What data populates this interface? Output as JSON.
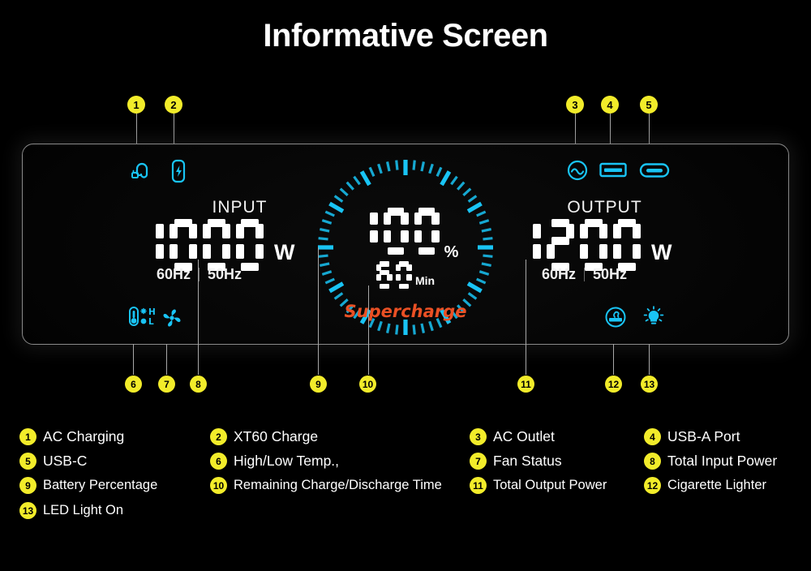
{
  "page": {
    "title": "Informative Screen",
    "background_color": "#000000",
    "accent_badge_color": "#F2EC2A",
    "icon_color": "#19C4F5",
    "supercharge_color": "#EA5024",
    "display_text_color": "#FFFFFF"
  },
  "display": {
    "input": {
      "heading": "INPUT",
      "value": "1000",
      "unit": "W",
      "freq_options": [
        "60Hz",
        "50Hz"
      ]
    },
    "output": {
      "heading": "OUTPUT",
      "value": "1200",
      "unit": "W",
      "freq_options": [
        "60Hz",
        "50Hz"
      ]
    },
    "gauge": {
      "percent_value": "100",
      "percent_unit": "%",
      "time_value": "60",
      "time_unit": "Min",
      "status_label": "Supercharge",
      "tick_count": 60,
      "major_tick_every": 5
    },
    "top_icons": [
      {
        "id": 1,
        "name": "ac-charging-icon",
        "glyph": "plug-cable"
      },
      {
        "id": 2,
        "name": "xt60-charge-icon",
        "glyph": "battery-bolt"
      },
      {
        "id": 3,
        "name": "ac-outlet-icon",
        "glyph": "circle-sine"
      },
      {
        "id": 4,
        "name": "usb-a-port-icon",
        "glyph": "rect-usb-a"
      },
      {
        "id": 5,
        "name": "usb-c-port-icon",
        "glyph": "oval-usb-c"
      }
    ],
    "bottom_icons": [
      {
        "id": 6,
        "name": "high-low-temp-icon",
        "glyph": "thermometer",
        "high_label": "H",
        "low_label": "L"
      },
      {
        "id": 7,
        "name": "fan-status-icon",
        "glyph": "fan"
      },
      {
        "id": 12,
        "name": "cigarette-lighter-icon",
        "glyph": "circle-lighter"
      },
      {
        "id": 13,
        "name": "led-light-icon",
        "glyph": "bulb"
      }
    ]
  },
  "callouts": [
    {
      "id": "1",
      "number": "1"
    },
    {
      "id": "2",
      "number": "2"
    },
    {
      "id": "3",
      "number": "3"
    },
    {
      "id": "4",
      "number": "4"
    },
    {
      "id": "5",
      "number": "5"
    },
    {
      "id": "6",
      "number": "6"
    },
    {
      "id": "7",
      "number": "7"
    },
    {
      "id": "8",
      "number": "8"
    },
    {
      "id": "9",
      "number": "9"
    },
    {
      "id": "10",
      "number": "10"
    },
    {
      "id": "11",
      "number": "11"
    },
    {
      "id": "12",
      "number": "12"
    },
    {
      "id": "13",
      "number": "13"
    }
  ],
  "legend": {
    "rows": [
      [
        {
          "number": "1",
          "label": "AC Charging"
        },
        {
          "number": "2",
          "label": "XT60 Charge"
        },
        {
          "number": "3",
          "label": "AC Outlet"
        },
        {
          "number": "4",
          "label": "USB-A Port"
        }
      ],
      [
        {
          "number": "5",
          "label": "USB-C"
        },
        {
          "number": "6",
          "label": "High/Low Temp.,"
        },
        {
          "number": "7",
          "label": "Fan Status"
        },
        {
          "number": "8",
          "label": "Total Input Power"
        }
      ],
      [
        {
          "number": "9",
          "label": "Battery Percentage"
        },
        {
          "number": "10",
          "label": "Remaining Charge/Discharge Time"
        },
        {
          "number": "11",
          "label": "Total Output Power"
        },
        {
          "number": "12",
          "label": "Cigarette Lighter"
        }
      ],
      [
        {
          "number": "13",
          "label": "LED Light On"
        }
      ]
    ]
  }
}
